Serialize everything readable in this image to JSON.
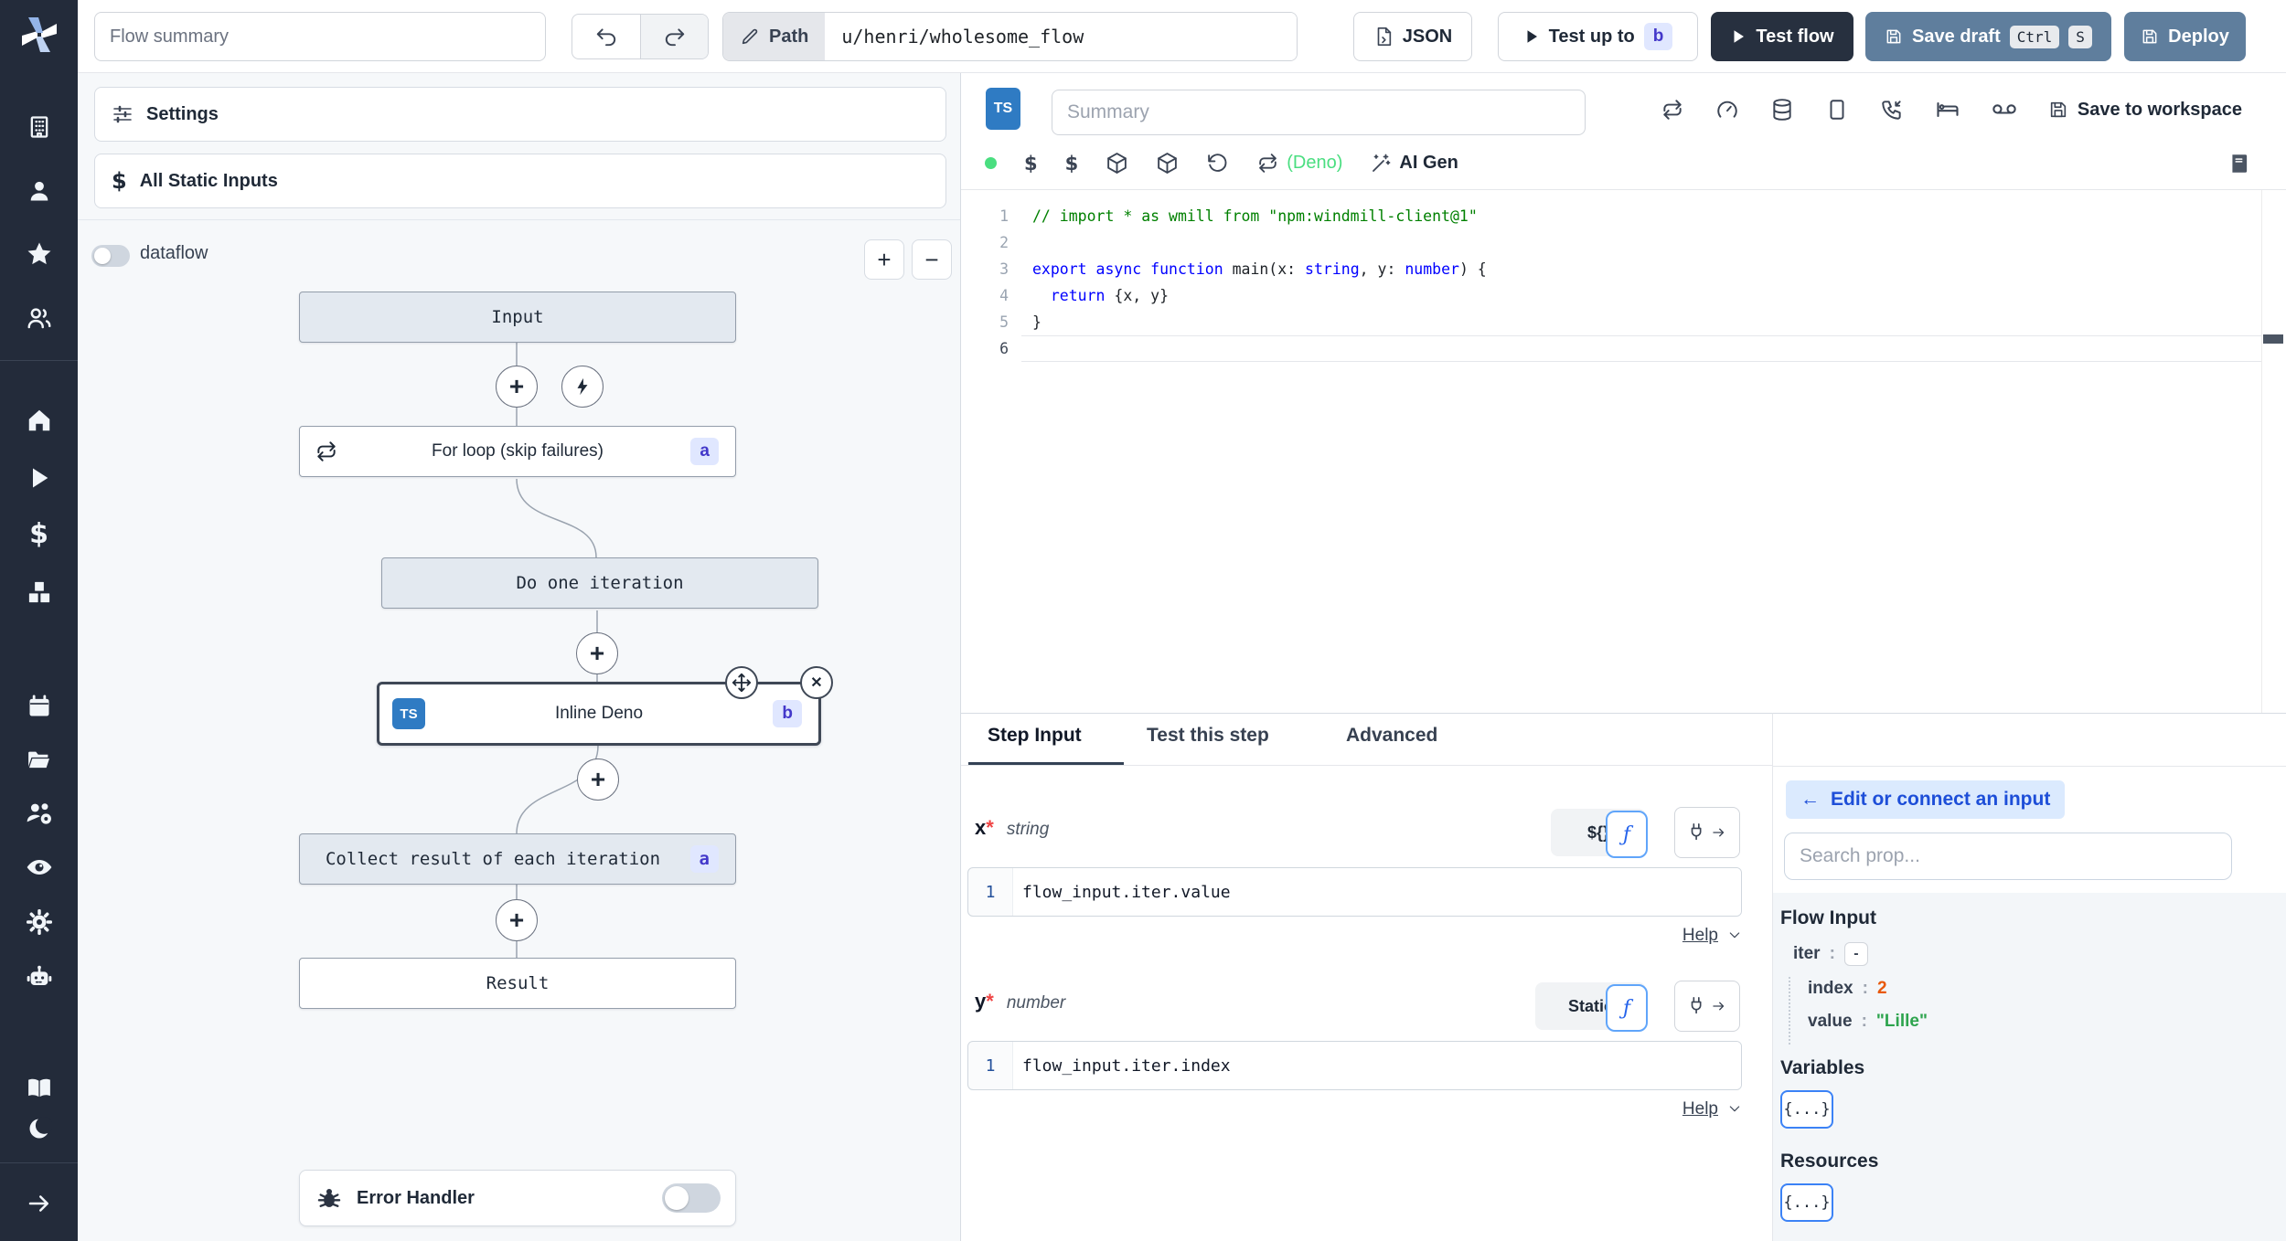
{
  "topbar": {
    "flow_summary_placeholder": "Flow summary",
    "path_label": "Path",
    "path_value": "u/henri/wholesome_flow",
    "json_label": "JSON",
    "test_up_to_label": "Test up to",
    "test_up_to_badge": "b",
    "test_flow_label": "Test flow",
    "save_draft_label": "Save draft",
    "save_draft_kbd_ctrl": "Ctrl",
    "save_draft_kbd_s": "S",
    "deploy_label": "Deploy"
  },
  "sidebar": {
    "icons_top": [
      "windmill-logo",
      "building",
      "user",
      "star",
      "users"
    ],
    "icons_middle": [
      "home",
      "play",
      "dollar",
      "cubes"
    ],
    "icons_lower": [
      "calendar",
      "folder-open",
      "users-gear",
      "eye",
      "gear",
      "robot"
    ],
    "icons_bottom": [
      "book-open",
      "moon",
      "arrow-right"
    ],
    "dollar_glyph": "$"
  },
  "left_panel": {
    "settings_label": "Settings",
    "all_static_inputs_label": "All Static Inputs",
    "static_inputs_glyph": "$",
    "dataflow_label": "dataflow",
    "zoom_in_label": "+",
    "zoom_out_label": "−"
  },
  "graph": {
    "input_label": "Input",
    "for_loop_label": "For loop (skip failures)",
    "for_loop_badge": "a",
    "iteration_label": "Do one iteration",
    "inline_step_label": "Inline Deno",
    "inline_step_badge": "b",
    "inline_step_lang": "TS",
    "collect_label": "Collect result of each iteration",
    "collect_badge": "a",
    "result_label": "Result",
    "error_handler_label": "Error Handler",
    "plus_glyph": "+",
    "close_glyph": "✕"
  },
  "editor": {
    "lang_badge": "TS",
    "summary_placeholder": "Summary",
    "runtime_label": "(Deno)",
    "ai_gen_label": "AI Gen",
    "save_to_workspace_label": "Save to workspace",
    "dollar_glyph": "$",
    "code_lines": [
      [
        {
          "t": "// import * as wmill from \"npm:windmill-client@1\"",
          "c": "comment"
        }
      ],
      [],
      [
        {
          "t": "export",
          "c": "kw"
        },
        {
          "t": " ",
          "c": "plain"
        },
        {
          "t": "async",
          "c": "kw"
        },
        {
          "t": " ",
          "c": "plain"
        },
        {
          "t": "function",
          "c": "kw"
        },
        {
          "t": " main(x: ",
          "c": "plain"
        },
        {
          "t": "string",
          "c": "type"
        },
        {
          "t": ", y: ",
          "c": "plain"
        },
        {
          "t": "number",
          "c": "type"
        },
        {
          "t": ") {",
          "c": "plain"
        }
      ],
      [
        {
          "t": "  ",
          "c": "plain"
        },
        {
          "t": "return",
          "c": "kw"
        },
        {
          "t": " {x, y}",
          "c": "plain"
        }
      ],
      [
        {
          "t": "}",
          "c": "plain"
        }
      ],
      []
    ]
  },
  "step_panel": {
    "tabs": [
      "Step Input",
      "Test this step",
      "Advanced"
    ],
    "fields": {
      "x": {
        "name": "x",
        "required_mark": "*",
        "type": "string",
        "mode_label": "${}",
        "fn_label": "ƒ",
        "line_number": "1",
        "expression": "flow_input.iter.value",
        "help_label": "Help"
      },
      "y": {
        "name": "y",
        "required_mark": "*",
        "type": "number",
        "mode_label": "Static",
        "fn_label": "ƒ",
        "line_number": "1",
        "expression": "flow_input.iter.index",
        "help_label": "Help"
      }
    }
  },
  "connect_panel": {
    "back_arrow": "←",
    "back_label": "Edit or connect an input",
    "search_placeholder": "Search prop...",
    "flow_input_title": "Flow Input",
    "tree": {
      "iter_key": "iter",
      "colon": ":",
      "iter_collapse": "-",
      "index_key": "index",
      "index_value": "2",
      "value_key": "value",
      "value_value": "\"Lille\""
    },
    "variables_title": "Variables",
    "resources_title": "Resources",
    "object_chip": "{...}"
  },
  "colors": {
    "sidebar_bg": "#232b3a",
    "accent_ts_blue": "#2f7bc3",
    "button_slate": "#5f7e9d",
    "button_dark": "#27303f",
    "badge_indigo_bg": "#e0e7ff",
    "badge_indigo_text": "#4338ca",
    "runtime_green": "#4ade80",
    "number_orange": "#e8590c",
    "string_green": "#2da44e",
    "pill_blue_bg": "#dbeafe",
    "pill_blue_text": "#1d4ed8"
  }
}
